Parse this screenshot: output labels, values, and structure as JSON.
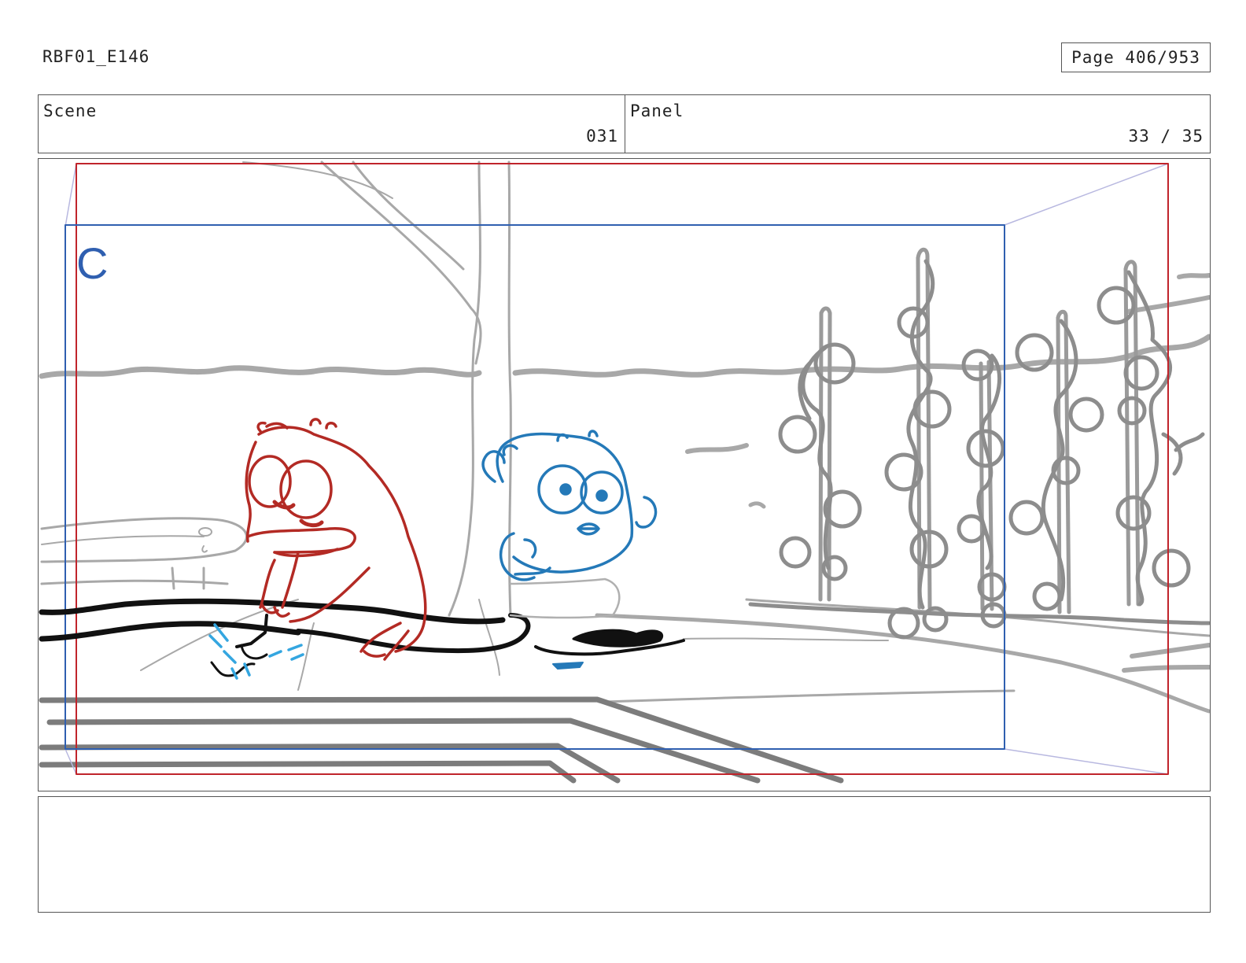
{
  "header": {
    "production_code": "RBF01_E146",
    "page_label": "Page 406/953"
  },
  "info": {
    "scene_label": "Scene",
    "scene_value": "031",
    "panel_label": "Panel",
    "panel_value": "33 / 35"
  },
  "artwork": {
    "camera_marker": "C",
    "colors": {
      "field_red": "#c0242b",
      "field_blue": "#2f5fb0",
      "character_red": "#b32a24",
      "character_blue": "#2479b8",
      "background_gray": "#a5a5a5",
      "ink_black": "#111111",
      "water_blue": "#34a6e0"
    }
  },
  "notes": {
    "text": ""
  }
}
